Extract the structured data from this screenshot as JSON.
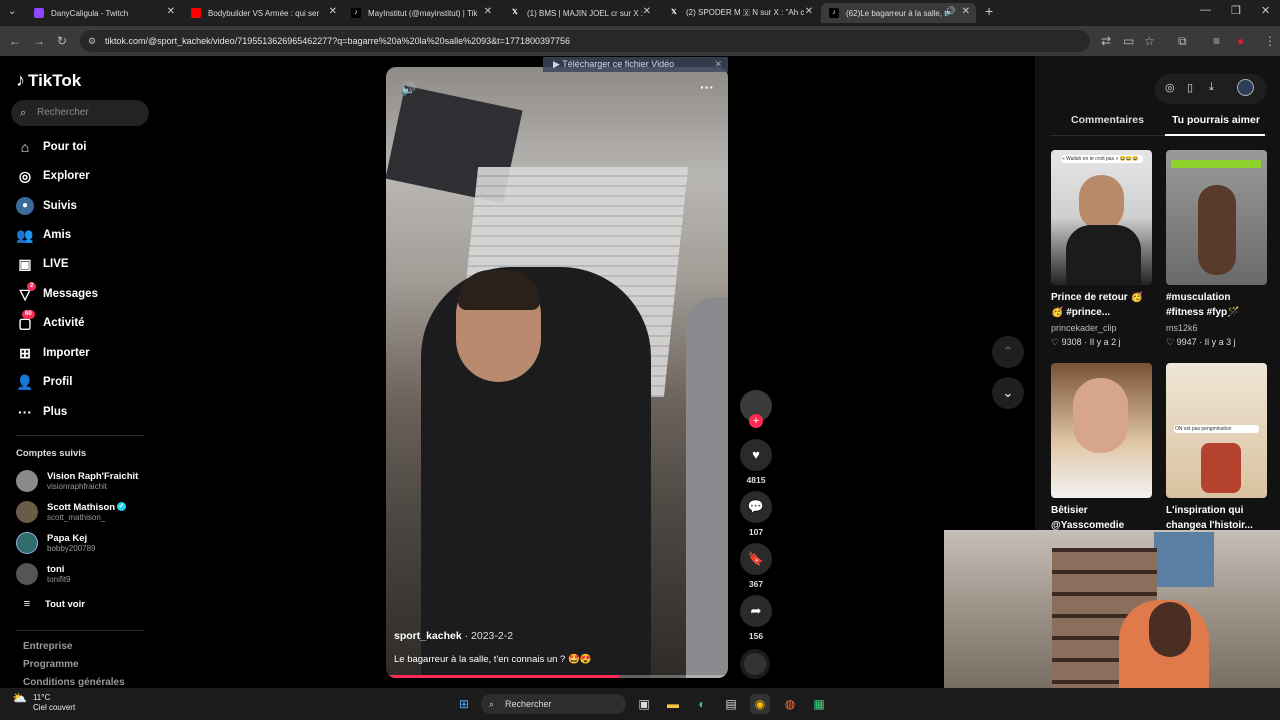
{
  "browser": {
    "tabs": [
      {
        "title": "DanyCaligula - Twitch",
        "icon": "twitch-icon"
      },
      {
        "title": "Bodybuilder VS Armée : qui ser",
        "icon": "youtube-icon"
      },
      {
        "title": "MayInstitut (@mayinstitut) | Tik",
        "icon": "tiktok-icon"
      },
      {
        "title": "(1) BMS | MAJIN JOEL cr sur X :",
        "icon": "x-icon"
      },
      {
        "title": "(2) SPODER M 🇽 N sur X : \"Ah c",
        "icon": "x-icon"
      },
      {
        "title": "(62)Le bagarreur à la salle, t",
        "icon": "tiktok-icon"
      }
    ],
    "url": "tiktok.com/@sport_kachek/video/7195513626965462277?q=bagarre%20à%20la%20salle%2093&t=1771800397756"
  },
  "sidebar": {
    "logo": "TikTok",
    "search_placeholder": "Rechercher",
    "nav": [
      {
        "label": "Pour toi",
        "icon": "home-icon"
      },
      {
        "label": "Explorer",
        "icon": "compass-icon"
      },
      {
        "label": "Suivis",
        "icon": "following-icon"
      },
      {
        "label": "Amis",
        "icon": "friends-icon"
      },
      {
        "label": "LIVE",
        "icon": "live-icon"
      },
      {
        "label": "Messages",
        "icon": "messages-icon",
        "badge": "2"
      },
      {
        "label": "Activité",
        "icon": "activity-icon",
        "badge": "60"
      },
      {
        "label": "Importer",
        "icon": "upload-icon"
      },
      {
        "label": "Profil",
        "icon": "profile-icon"
      },
      {
        "label": "Plus",
        "icon": "more-icon"
      }
    ],
    "followed_title": "Comptes suivis",
    "accounts": [
      {
        "name": "Vision Raph'Fraichit",
        "handle": "visionraphfraichit"
      },
      {
        "name": "Scott Mathison",
        "handle": "scott_mathison_"
      },
      {
        "name": "Papa Kej",
        "handle": "bobby200789"
      },
      {
        "name": "toni",
        "handle": "tonifit9"
      }
    ],
    "see_all": "Tout voir",
    "footer_links": [
      "Entreprise",
      "Programme",
      "Conditions générales"
    ]
  },
  "video": {
    "download_banner": "Télécharger ce fichier Vidéo",
    "author": "sport_kachek",
    "date": " · 2023-2-2",
    "caption": "Le bagarreur à la salle, t'en connais un ? 🤩😍",
    "progress": 0.68
  },
  "actions": {
    "likes": "4815",
    "comments": "107",
    "saves": "367",
    "shares": "156"
  },
  "right_panel": {
    "tab_comments": "Commentaires",
    "tab_suggested": "Tu pourrais aimer",
    "videos": [
      {
        "title": "Prince de retour 🥳🥳 #prince...",
        "user": "princekader_clip",
        "likes": "9308",
        "age": "Il y a 2 j",
        "thumb_text": "« Wallah on te croit pas » 😂😂😂"
      },
      {
        "title": "#musculation #fitness #fyp🪄",
        "user": "ms12k6",
        "likes": "9947",
        "age": "Il y a 3 j",
        "thumb_text": ""
      },
      {
        "title": "Bêtisier @Yasscomedie",
        "user": "",
        "likes": "",
        "age": "",
        "thumb_text": ""
      },
      {
        "title": "L'inspiration qui changea l'histoir...",
        "user": "",
        "likes": "",
        "age": "",
        "thumb_text": "ON est pas pengmination"
      }
    ]
  },
  "taskbar": {
    "temp": "11°C",
    "weather": "Ciel couvert",
    "search": "Rechercher"
  }
}
